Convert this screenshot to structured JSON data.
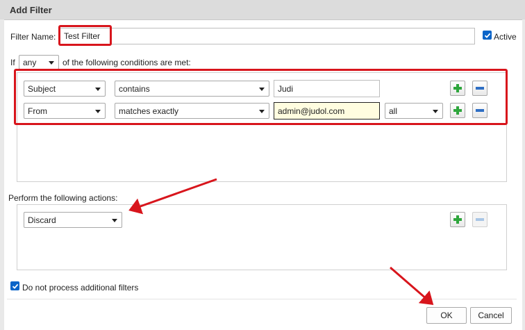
{
  "dialog": {
    "title": "Add Filter"
  },
  "filter": {
    "name_label": "Filter Name:",
    "name_value": "Test Filter",
    "active_label": "Active",
    "active_checked": true
  },
  "conditions": {
    "prefix": "If",
    "match_mode": "any",
    "suffix": "of the following conditions are met:",
    "rows": [
      {
        "field": "Subject",
        "operator": "contains",
        "value": "Judi",
        "scope": ""
      },
      {
        "field": "From",
        "operator": "matches exactly",
        "value": "admin@judol.com",
        "scope": "all"
      }
    ]
  },
  "actions": {
    "heading": "Perform the following actions:",
    "rows": [
      {
        "action": "Discard"
      }
    ]
  },
  "options": {
    "stop_label": "Do not process additional filters",
    "stop_checked": true
  },
  "buttons": {
    "ok": "OK",
    "cancel": "Cancel"
  },
  "colors": {
    "highlight": "#d8151c",
    "checkbox": "#0a64c8",
    "add_icon": "#2ea63c",
    "remove_icon": "#2f6fc4",
    "focused_field": "#fffde0"
  }
}
